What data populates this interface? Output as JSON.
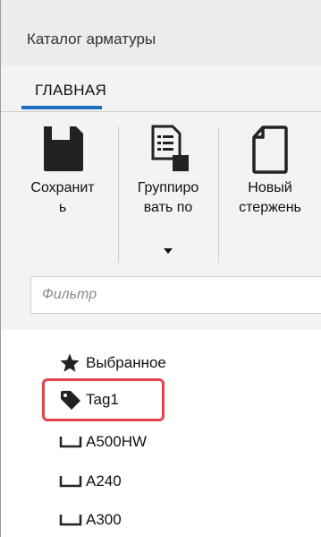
{
  "window": {
    "title": "Каталог арматуры"
  },
  "ribbon": {
    "tab": "ГЛАВНАЯ",
    "buttons": [
      {
        "label": "Сохранит\nь",
        "icon": "save-icon"
      },
      {
        "label": "Группиро\nвать по",
        "icon": "group-by-icon",
        "has_dropdown": true
      },
      {
        "label": "Новый\nстержень",
        "icon": "new-document-icon"
      }
    ]
  },
  "filter": {
    "placeholder": "Фильтр",
    "value": ""
  },
  "tree": {
    "items": [
      {
        "label": "Выбранное",
        "icon": "star-icon"
      },
      {
        "label": "Tag1",
        "icon": "tag-icon",
        "highlighted": true
      },
      {
        "label": "A500HW",
        "icon": "rebar-shape-icon"
      },
      {
        "label": "A240",
        "icon": "rebar-shape-icon"
      },
      {
        "label": "A300",
        "icon": "rebar-shape-icon"
      }
    ]
  },
  "colors": {
    "accent": "#1e6fc0",
    "highlight": "#e0454b",
    "ribbon_bg": "#f3f3f3"
  }
}
